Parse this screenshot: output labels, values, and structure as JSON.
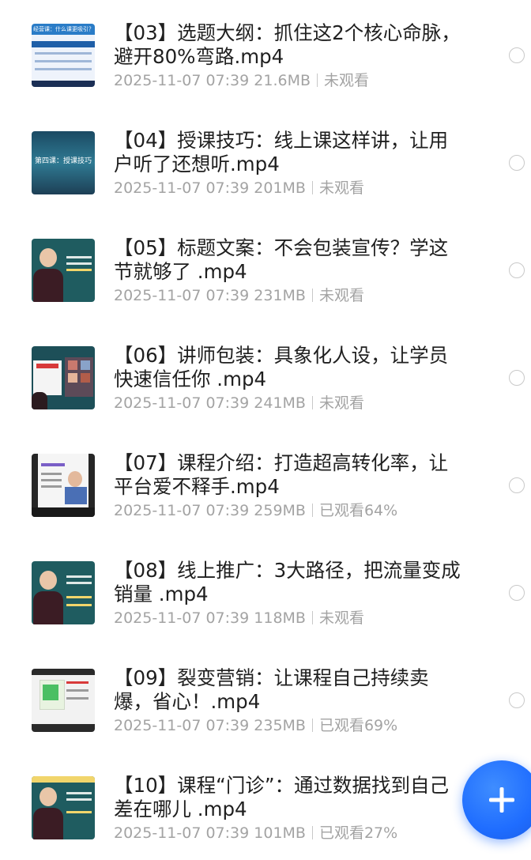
{
  "videos": [
    {
      "title": "【03】选题大纲：抓住这2个核心命脉，避开80%弯路.mp4",
      "date": "2025-11-07 07:39",
      "size": "21.6MB",
      "status": "未观看",
      "thumb_text": "经营课：什么课更吸引？"
    },
    {
      "title": "【04】授课技巧：线上课这样讲，让用户听了还想听.mp4",
      "date": "2025-11-07 07:39",
      "size": "201MB",
      "status": "未观看",
      "thumb_text": "第四课：授课技巧"
    },
    {
      "title": "【05】标题文案：不会包装宣传？学这节就够了 .mp4",
      "date": "2025-11-07 07:39",
      "size": "231MB",
      "status": "未观看",
      "thumb_text": ""
    },
    {
      "title": "【06】讲师包装：具象化人设，让学员快速信任你 .mp4",
      "date": "2025-11-07 07:39",
      "size": "241MB",
      "status": "未观看",
      "thumb_text": ""
    },
    {
      "title": "【07】课程介绍：打造超高转化率，让平台爱不释手.mp4",
      "date": "2025-11-07 07:39",
      "size": "259MB",
      "status": "已观看64%",
      "thumb_text": ""
    },
    {
      "title": "【08】线上推广：3大路径，把流量变成销量 .mp4",
      "date": "2025-11-07 07:39",
      "size": "118MB",
      "status": "未观看",
      "thumb_text": ""
    },
    {
      "title": "【09】裂变营销：让课程自己持续卖爆，省心！.mp4",
      "date": "2025-11-07 07:39",
      "size": "235MB",
      "status": "已观看69%",
      "thumb_text": ""
    },
    {
      "title": "【10】课程“门诊”：通过数据找到自己差在哪儿 .mp4",
      "date": "2025-11-07 07:39",
      "size": "101MB",
      "status": "已观看27%",
      "thumb_text": ""
    }
  ],
  "icons": {
    "radio": "radio-circle-icon",
    "fab": "plus-icon"
  },
  "colors": {
    "accent": "#1f6dff",
    "meta_text": "#a3a3a3",
    "title_text": "#1f1f1f"
  }
}
